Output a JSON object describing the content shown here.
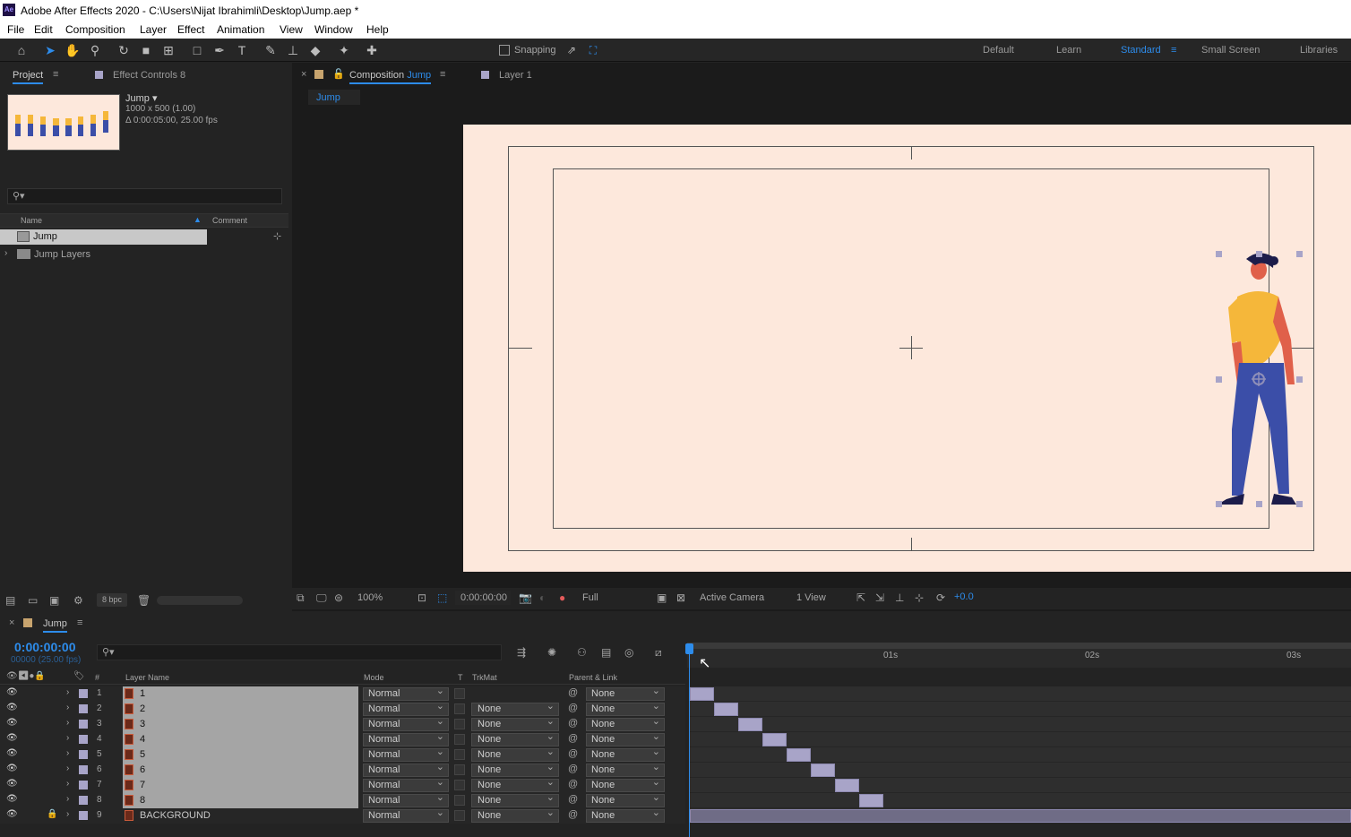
{
  "window": {
    "title": "Adobe After Effects 2020 - C:\\Users\\Nijat Ibrahimli\\Desktop\\Jump.aep *",
    "app_badge": "Ae"
  },
  "menu": [
    "File",
    "Edit",
    "Composition",
    "Layer",
    "Effect",
    "Animation",
    "View",
    "Window",
    "Help"
  ],
  "toolbar": {
    "snapping_label": "Snapping",
    "workspaces": [
      "Default",
      "Learn",
      "Standard",
      "Small Screen",
      "Libraries"
    ],
    "active_workspace": "Standard"
  },
  "project": {
    "tab_label": "Project",
    "effect_controls_label": "Effect Controls 8",
    "comp_name": "Jump ▾",
    "comp_size": "1000 x 500 (1.00)",
    "comp_duration": "Δ 0:00:05:00, 25.00 fps",
    "col_name": "Name",
    "col_comment": "Comment",
    "items": [
      {
        "label": "Jump"
      },
      {
        "label": "Jump Layers"
      }
    ],
    "bpc": "8 bpc"
  },
  "composition": {
    "tab_prefix": "Composition",
    "tab_name": "Jump",
    "layer_tab": "Layer 1",
    "breadcrumb": "Jump",
    "zoom": "100%",
    "timecode": "0:00:00:00",
    "resolution": "Full",
    "camera": "Active Camera",
    "views": "1 View",
    "exposure": "+0.0"
  },
  "timeline": {
    "tab_label": "Jump",
    "timecode": "0:00:00:00",
    "frames": "00000 (25.00 fps)",
    "col_layer_name": "Layer Name",
    "col_mode": "Mode",
    "col_t": "T",
    "col_trkmat": "TrkMat",
    "col_parent": "Parent & Link",
    "col_hash": "#",
    "ruler": [
      "01s",
      "02s",
      "03s"
    ],
    "layers": [
      {
        "num": "1",
        "name": "1",
        "mode": "Normal",
        "trkmat": "",
        "parent": "None"
      },
      {
        "num": "2",
        "name": "2",
        "mode": "Normal",
        "trkmat": "None",
        "parent": "None"
      },
      {
        "num": "3",
        "name": "3",
        "mode": "Normal",
        "trkmat": "None",
        "parent": "None"
      },
      {
        "num": "4",
        "name": "4",
        "mode": "Normal",
        "trkmat": "None",
        "parent": "None"
      },
      {
        "num": "5",
        "name": "5",
        "mode": "Normal",
        "trkmat": "None",
        "parent": "None"
      },
      {
        "num": "6",
        "name": "6",
        "mode": "Normal",
        "trkmat": "None",
        "parent": "None"
      },
      {
        "num": "7",
        "name": "7",
        "mode": "Normal",
        "trkmat": "None",
        "parent": "None"
      },
      {
        "num": "8",
        "name": "8",
        "mode": "Normal",
        "trkmat": "None",
        "parent": "None"
      },
      {
        "num": "9",
        "name": "BACKGROUND",
        "mode": "Normal",
        "trkmat": "None",
        "parent": "None"
      }
    ]
  },
  "colors": {
    "accent": "#2d8ceb",
    "label_lavender": "#a8a4c8",
    "viewer_bg": "#fde8dc",
    "shirt": "#f5b73a",
    "pants": "#3b4ea8",
    "skin": "#e0604a"
  }
}
